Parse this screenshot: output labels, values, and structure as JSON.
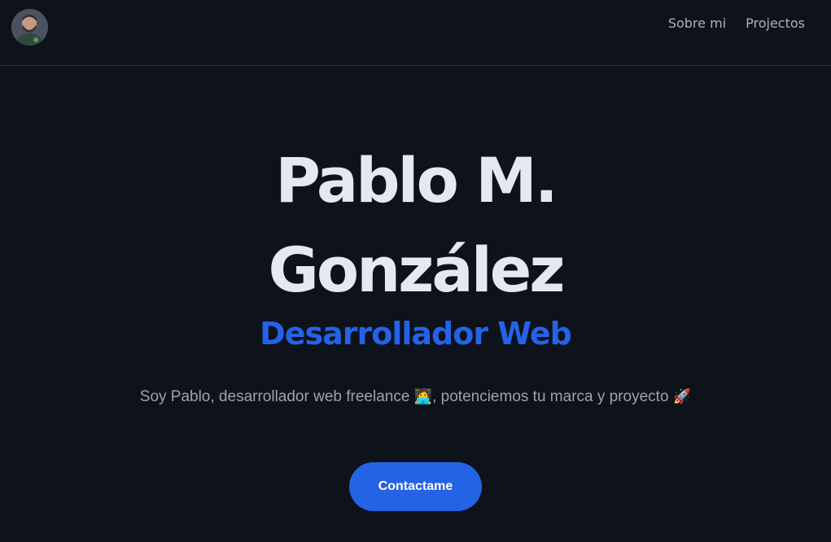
{
  "header": {
    "avatar_icon": "profile-photo",
    "nav": [
      {
        "label": "Sobre mi"
      },
      {
        "label": "Projectos"
      }
    ]
  },
  "hero": {
    "name_line1": "Pablo M.",
    "name_line2": "González",
    "role": "Desarrollador Web",
    "description_part1": "Soy Pablo, desarrollador web freelance",
    "emoji_laptop": "🧑‍💻",
    "description_part2": ", potenciemos tu marca y proyecto",
    "emoji_rocket": "🚀",
    "cta_label": "Contactame"
  },
  "colors": {
    "background": "#0d121b",
    "accent": "#2563e6",
    "title": "#e4e9f0",
    "text": "#9aa4b4"
  }
}
